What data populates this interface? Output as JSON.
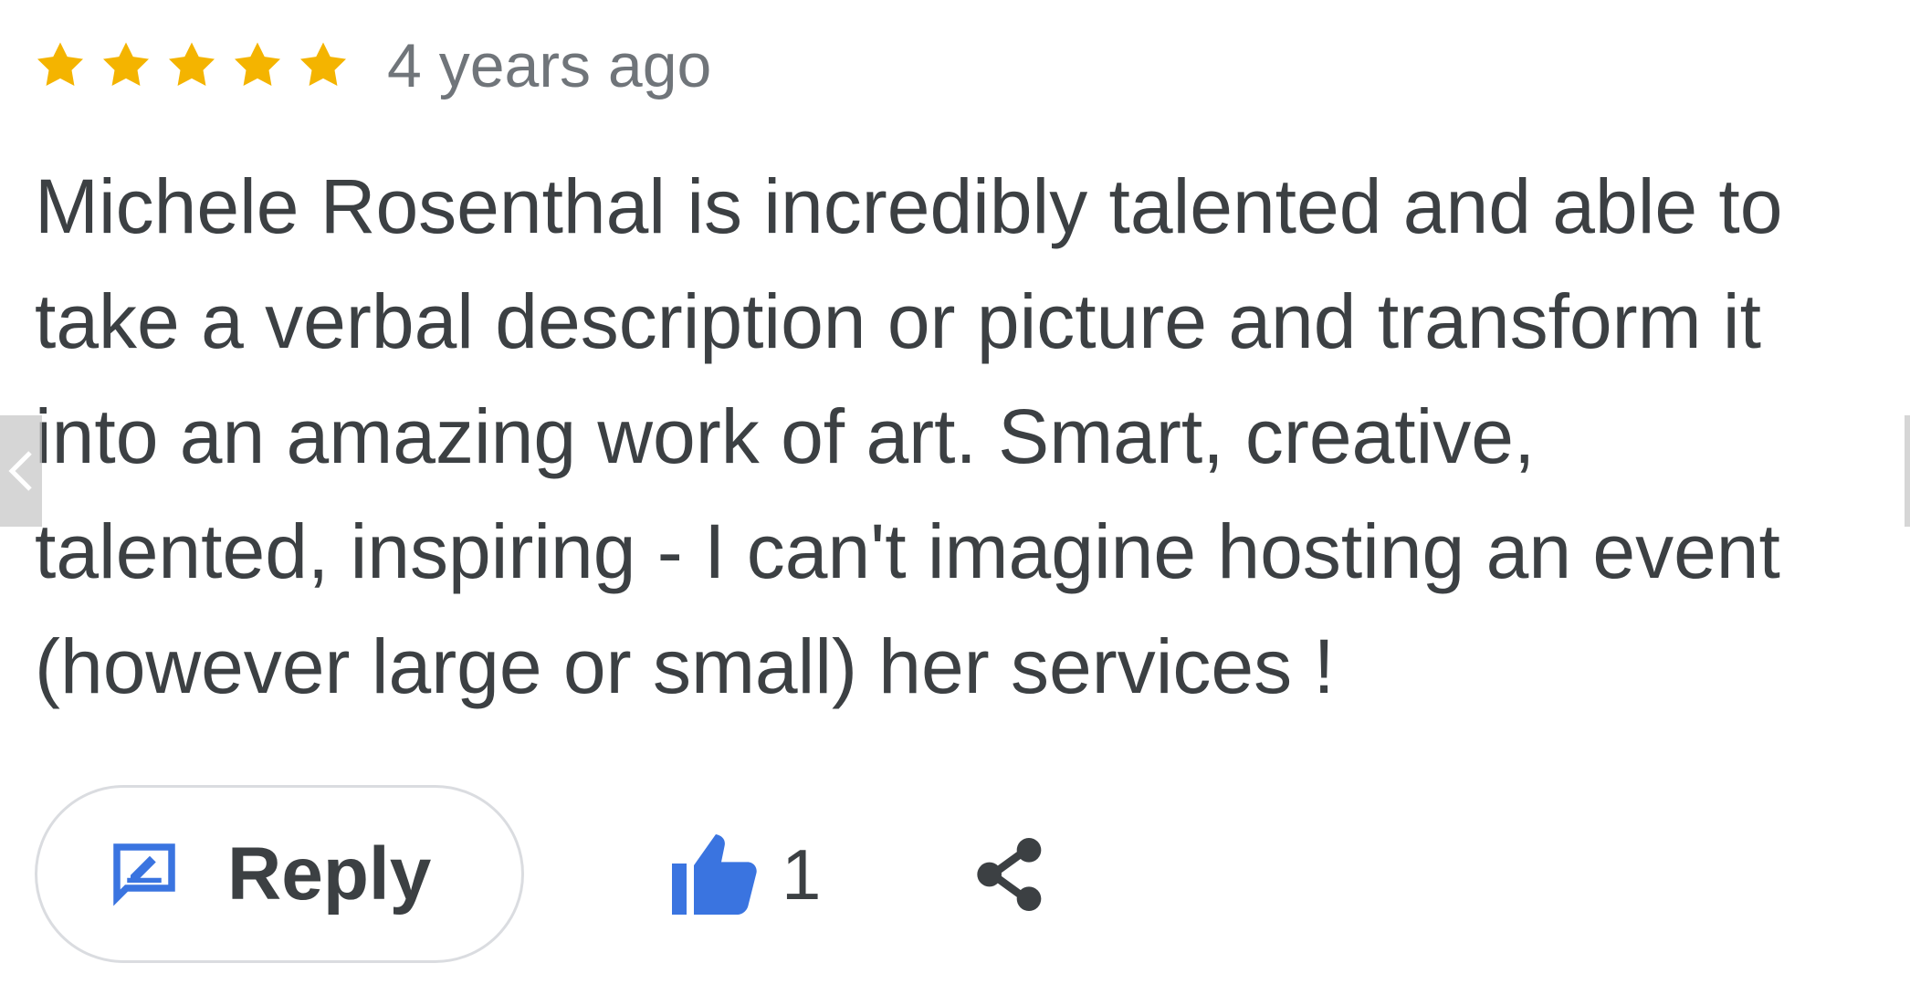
{
  "review": {
    "rating": 5,
    "rating_max": 5,
    "timestamp": "4 years ago",
    "text": "Michele Rosenthal is incredibly talented and able to\ntake a verbal description or picture and transform it\ninto an amazing work of art. Smart, creative,\ntalented, inspiring - I can't imagine hosting an event\n(however large or small) her services !"
  },
  "actions": {
    "reply_label": "Reply",
    "like_count": "1"
  },
  "icons": {
    "star": "star-icon",
    "reply": "reply-icon",
    "like": "thumbs-up-icon",
    "share": "share-icon",
    "carousel_prev": "chevron-left-icon"
  },
  "colors": {
    "star": "#f4b400",
    "accent": "#3a74e0",
    "text": "#3c4043",
    "muted": "#70757a",
    "border": "#dadce0"
  }
}
